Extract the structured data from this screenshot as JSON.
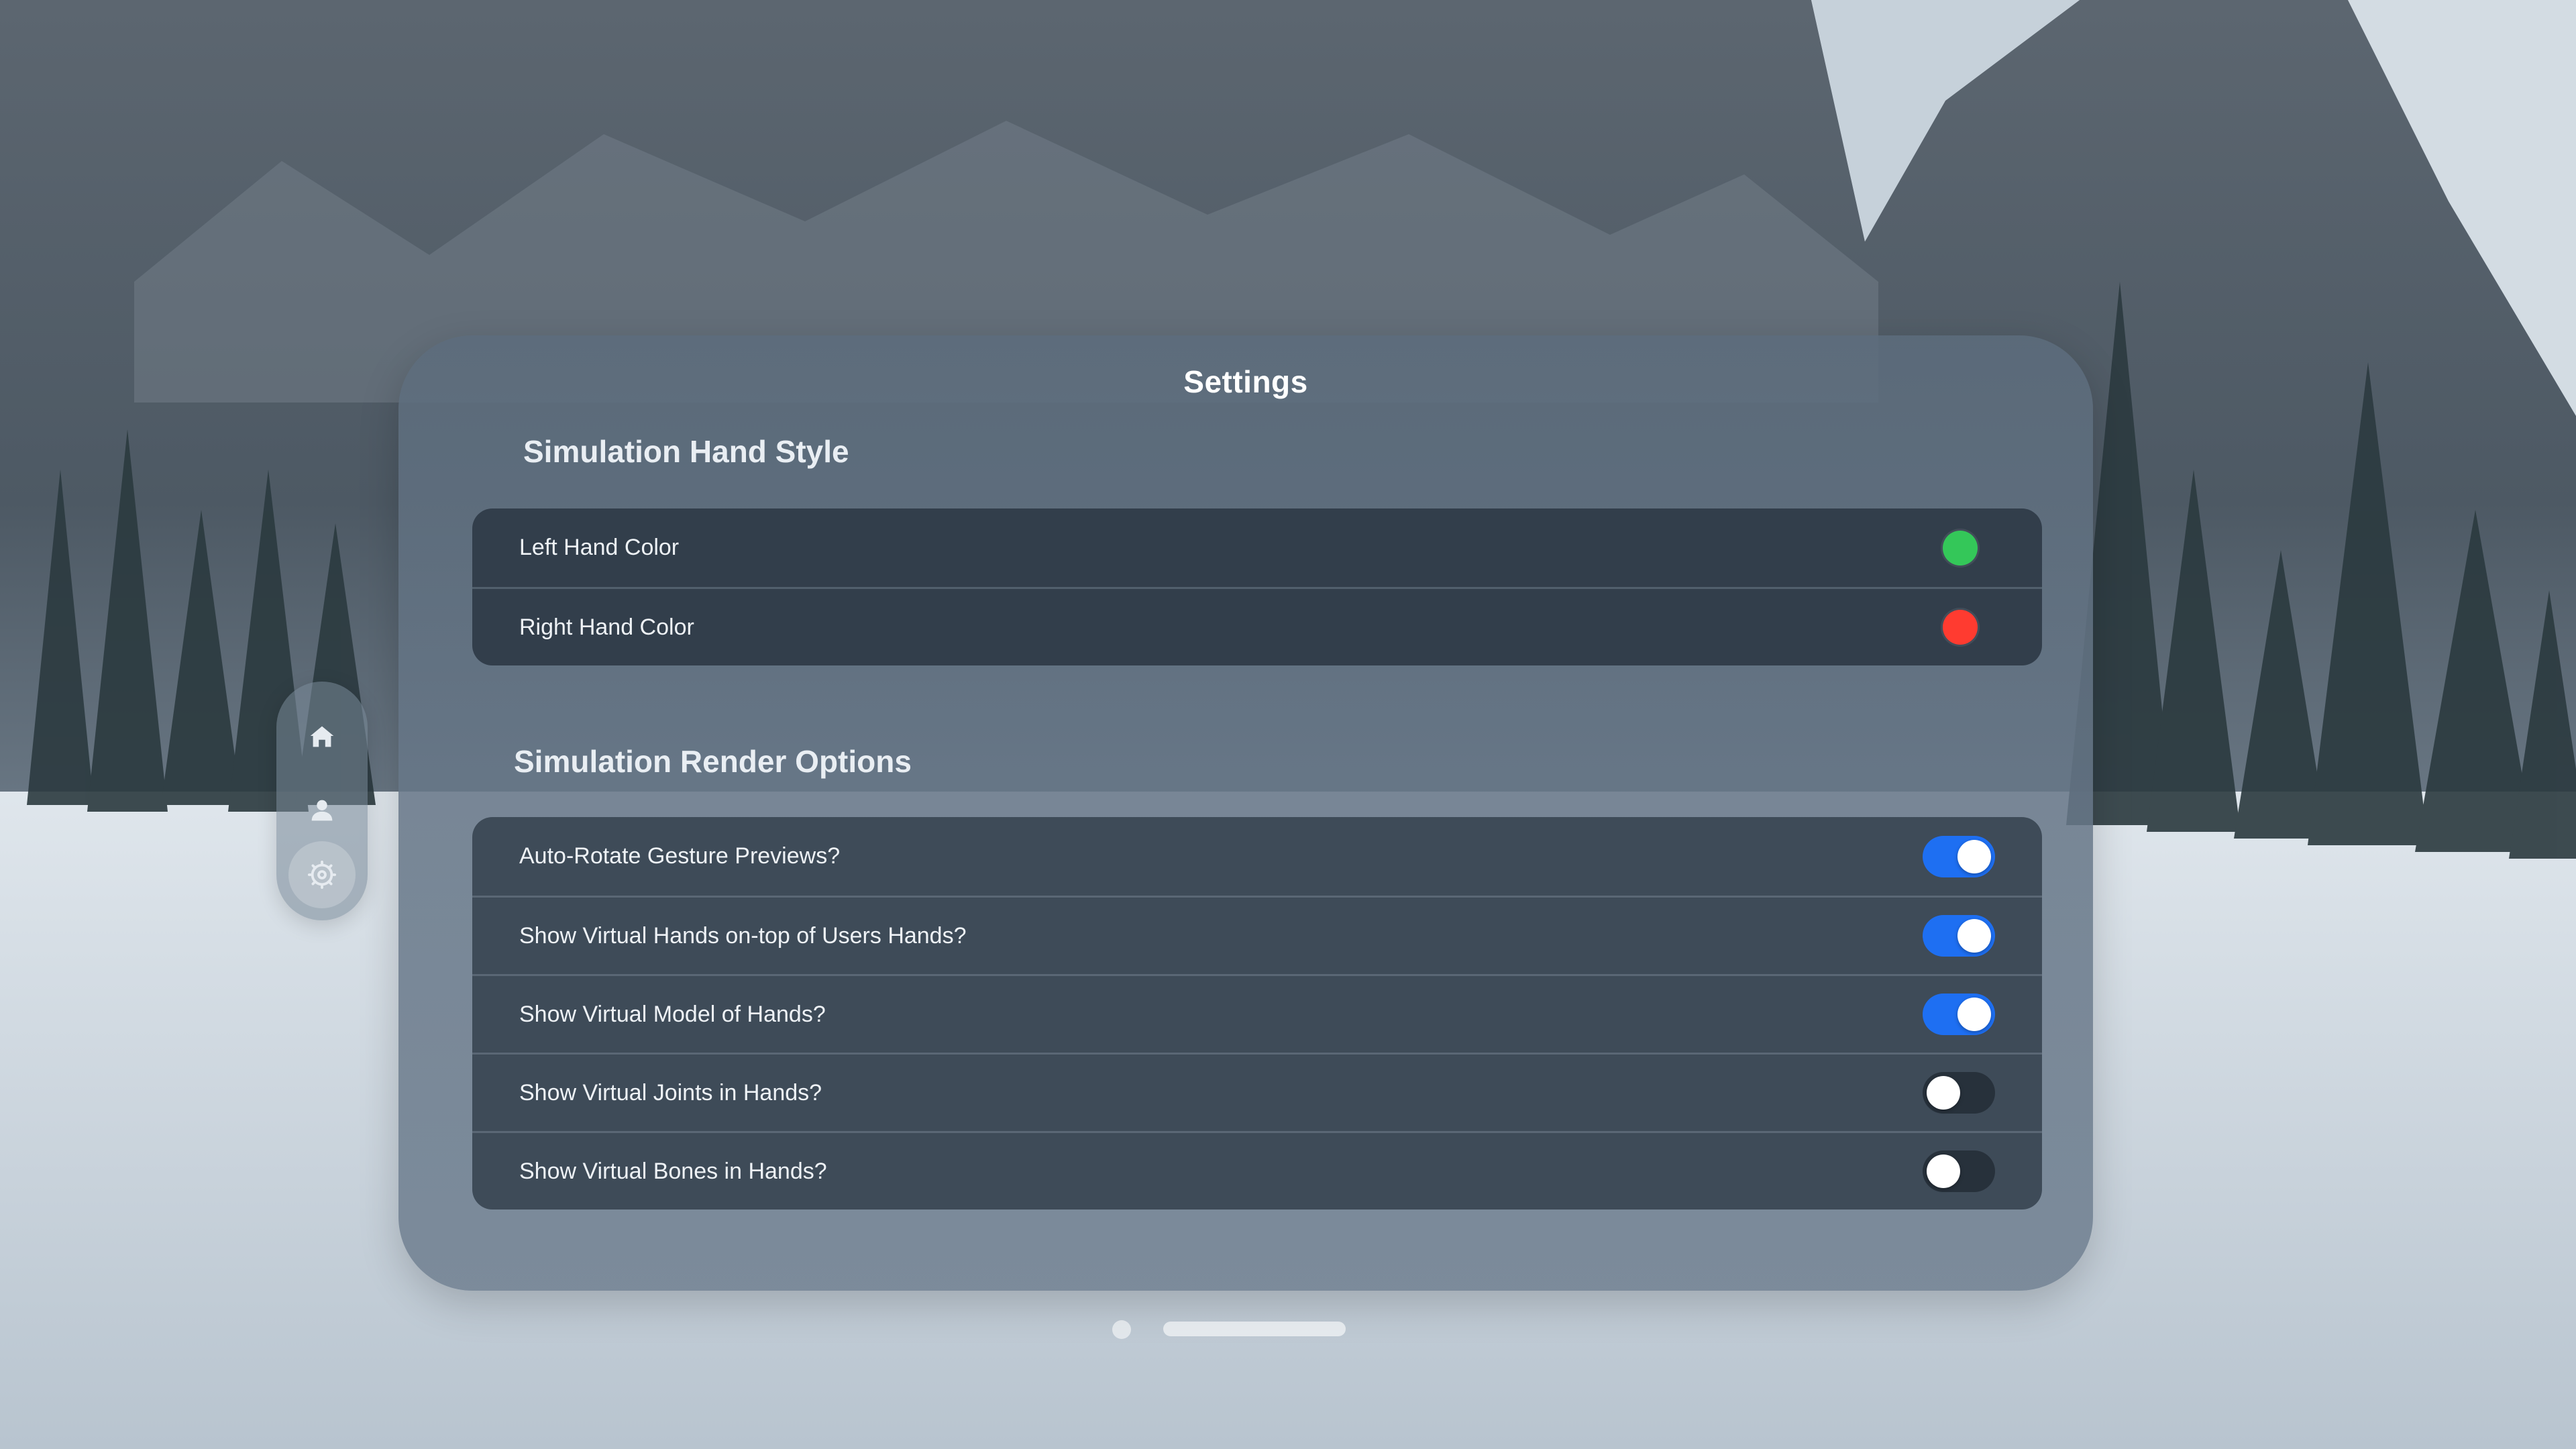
{
  "window": {
    "title": "Settings"
  },
  "ornament": {
    "items": [
      {
        "icon": "house-icon",
        "active": false
      },
      {
        "icon": "person-icon",
        "active": false
      },
      {
        "icon": "gear-icon",
        "active": true
      }
    ]
  },
  "hand_style": {
    "title": "Simulation Hand Style",
    "rows": [
      {
        "label": "Left Hand Color",
        "color": "#34c759"
      },
      {
        "label": "Right Hand Color",
        "color": "#ff3b30"
      }
    ]
  },
  "render_options": {
    "title": "Simulation Render Options",
    "rows": [
      {
        "label": "Auto-Rotate Gesture Previews?",
        "on": true
      },
      {
        "label": "Show Virtual Hands on-top of Users Hands?",
        "on": true
      },
      {
        "label": "Show Virtual Model of Hands?",
        "on": true
      },
      {
        "label": "Show Virtual Joints in Hands?",
        "on": false
      },
      {
        "label": "Show Virtual Bones in Hands?",
        "on": false
      }
    ]
  },
  "colors": {
    "toggle_on": "#1e6ff2",
    "toggle_off": "#27313b"
  }
}
